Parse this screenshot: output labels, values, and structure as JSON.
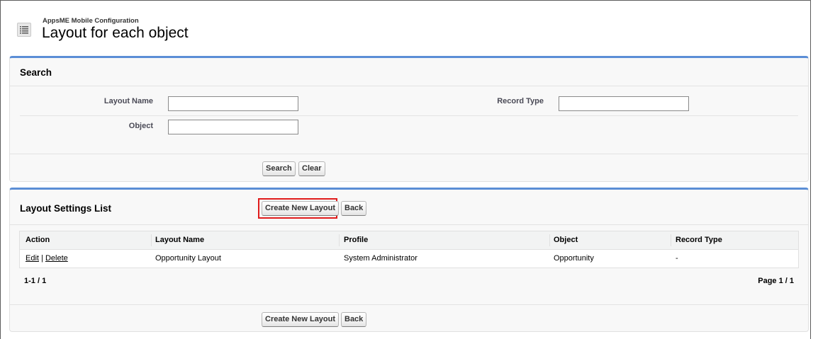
{
  "header": {
    "subtitle": "AppsME Mobile Configuration",
    "title": "Layout for each object",
    "icon": "list-icon"
  },
  "search": {
    "title": "Search",
    "fields": {
      "layout_name_label": "Layout Name",
      "layout_name_value": "",
      "record_type_label": "Record Type",
      "record_type_value": "",
      "object_label": "Object",
      "object_value": ""
    },
    "search_button": "Search",
    "clear_button": "Clear"
  },
  "list": {
    "title": "Layout Settings List",
    "create_button": "Create New Layout",
    "back_button": "Back",
    "columns": [
      "Action",
      "Layout Name",
      "Profile",
      "Object",
      "Record Type"
    ],
    "rows": [
      {
        "edit": "Edit",
        "separator": " | ",
        "delete": "Delete",
        "layout_name": "Opportunity Layout",
        "profile": "System Administrator",
        "object": "Opportunity",
        "record_type": "-"
      }
    ],
    "range": "1-1 / 1",
    "page": "Page 1 / 1",
    "footer_create_button": "Create New Layout",
    "footer_back_button": "Back"
  },
  "colors": {
    "block_border_top": "#5b8ed6",
    "highlight": "#e01b1b"
  }
}
